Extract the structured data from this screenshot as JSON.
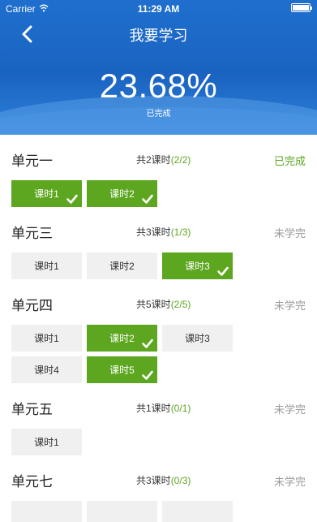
{
  "status_bar": {
    "carrier": "Carrier",
    "time": "11:29 AM"
  },
  "nav": {
    "title": "我要学习"
  },
  "progress": {
    "percent": "23.68%",
    "label": "已完成"
  },
  "units": [
    {
      "name": "单元一",
      "count_prefix": "共2课时",
      "fraction": "(2/2)",
      "status": "已完成",
      "completed": true,
      "lessons": [
        {
          "label": "课时1",
          "done": true
        },
        {
          "label": "课时2",
          "done": true
        }
      ]
    },
    {
      "name": "单元三",
      "count_prefix": "共3课时",
      "fraction": "(1/3)",
      "status": "未学完",
      "completed": false,
      "lessons": [
        {
          "label": "课时1",
          "done": false
        },
        {
          "label": "课时2",
          "done": false
        },
        {
          "label": "课时3",
          "done": true
        }
      ]
    },
    {
      "name": "单元四",
      "count_prefix": "共5课时",
      "fraction": "(2/5)",
      "status": "未学完",
      "completed": false,
      "lessons": [
        {
          "label": "课时1",
          "done": false
        },
        {
          "label": "课时2",
          "done": true
        },
        {
          "label": "课时3",
          "done": false
        },
        {
          "label": "课时4",
          "done": false
        },
        {
          "label": "课时5",
          "done": true
        }
      ]
    },
    {
      "name": "单元五",
      "count_prefix": "共1课时",
      "fraction": "(0/1)",
      "status": "未学完",
      "completed": false,
      "lessons": [
        {
          "label": "课时1",
          "done": false
        }
      ]
    },
    {
      "name": "单元七",
      "count_prefix": "共3课时",
      "fraction": "(0/3)",
      "status": "未学完",
      "completed": false,
      "lessons": [
        {
          "label": "",
          "done": false
        },
        {
          "label": "",
          "done": false
        },
        {
          "label": "",
          "done": false
        }
      ]
    }
  ],
  "colors": {
    "header": "#1a63c0",
    "accent_green": "#5da61f",
    "lesson_bg": "#f0f0f0"
  }
}
